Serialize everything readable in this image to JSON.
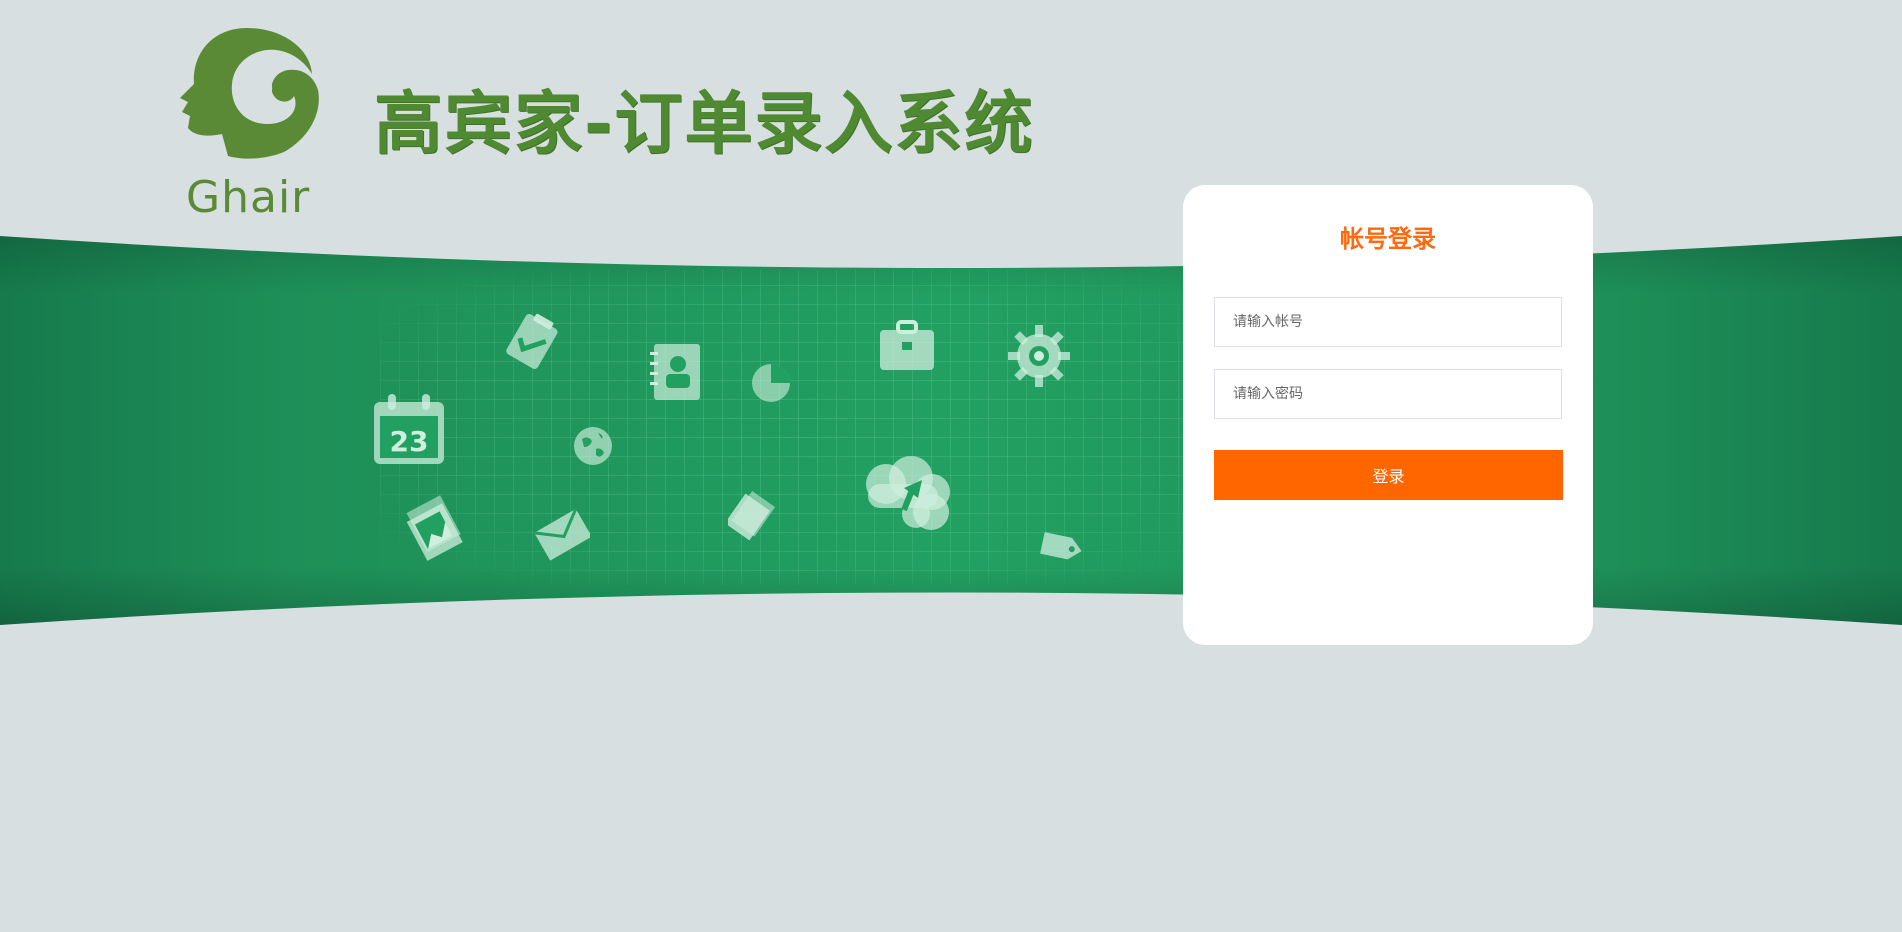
{
  "brand": {
    "logo_text": "Ghair",
    "site_title": "高宾家-订单录入系统"
  },
  "banner": {
    "calendar_day": "23",
    "icons": [
      "calendar-icon",
      "clipboard-icon",
      "contact-book-icon",
      "pie-chart-icon",
      "briefcase-icon",
      "gear-icon",
      "globe-icon",
      "photos-icon",
      "envelope-icon",
      "cards-icon",
      "cloud-share-icon",
      "tag-icon"
    ]
  },
  "login": {
    "title": "帐号登录",
    "account_placeholder": "请输入帐号",
    "password_placeholder": "请输入密码",
    "submit_label": "登录"
  },
  "colors": {
    "page_bg": "#d7dfe1",
    "band_green": "#1e8a55",
    "brand_green": "#4f8a32",
    "accent_orange": "#ff6600"
  }
}
